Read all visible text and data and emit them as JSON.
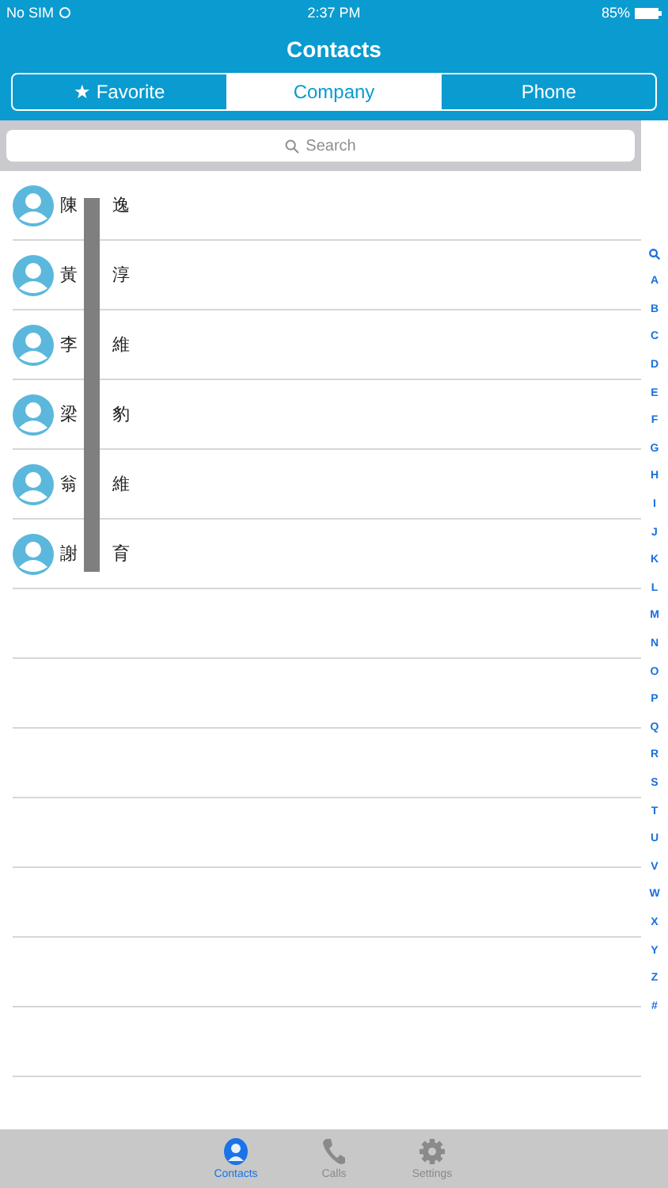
{
  "status_bar": {
    "carrier": "No SIM",
    "time": "2:37 PM",
    "battery": "85%"
  },
  "title": "Contacts",
  "tabs": [
    {
      "label": "Favorite",
      "icon": "★",
      "selected": false
    },
    {
      "label": "Company",
      "selected": true
    },
    {
      "label": "Phone",
      "selected": false
    }
  ],
  "search": {
    "placeholder": "Search"
  },
  "contacts": [
    {
      "name_start": "陳",
      "name_end": "逸"
    },
    {
      "name_start": "黃",
      "name_end": "淳"
    },
    {
      "name_start": "李",
      "name_end": "維"
    },
    {
      "name_start": "梁",
      "name_end": "豹"
    },
    {
      "name_start": "翁",
      "name_end": "維"
    },
    {
      "name_start": "謝",
      "name_end": "育"
    }
  ],
  "index": [
    "A",
    "B",
    "C",
    "D",
    "E",
    "F",
    "G",
    "H",
    "I",
    "J",
    "K",
    "L",
    "M",
    "N",
    "O",
    "P",
    "Q",
    "R",
    "S",
    "T",
    "U",
    "V",
    "W",
    "X",
    "Y",
    "Z",
    "#"
  ],
  "tab_bar": [
    {
      "kind": "contacts",
      "label": "Contacts",
      "selected": true
    },
    {
      "kind": "calls",
      "label": "Calls",
      "selected": false
    },
    {
      "kind": "settings",
      "label": "Settings",
      "selected": false
    }
  ]
}
